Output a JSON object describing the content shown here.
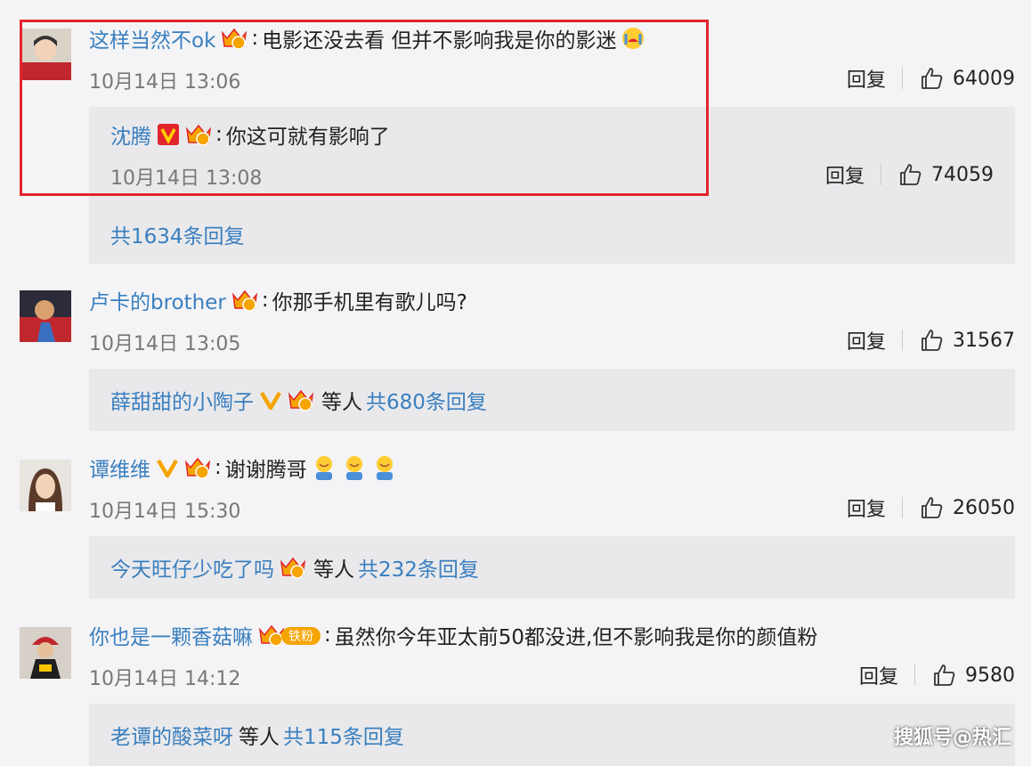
{
  "reply_label": "回复",
  "c1": {
    "user": "这样当然不ok",
    "text": "电影还没去看  但并不影响我是你的影迷",
    "time": "10月14日 13:06",
    "likes": "64009",
    "reply": {
      "user": "沈腾",
      "text": "你这可就有影响了",
      "time": "10月14日 13:08",
      "likes": "74059"
    },
    "more": "共1634条回复"
  },
  "c2": {
    "user": "卢卡的brother",
    "text": "你那手机里有歌儿吗?",
    "time": "10月14日 13:05",
    "likes": "31567",
    "sub_user": "薛甜甜的小陶子",
    "sub_etc": "等人",
    "more": "共680条回复"
  },
  "c3": {
    "user": "谭维维",
    "text": "谢谢腾哥",
    "time": "10月14日 15:30",
    "likes": "26050",
    "sub_user": "今天旺仔少吃了吗",
    "sub_etc": "等人",
    "more": "共232条回复"
  },
  "c4": {
    "user": "你也是一颗香菇嘛",
    "fan_badge": "铁粉",
    "text": "虽然你今年亚太前50都没进,但不影响我是你的颜值粉",
    "time": "10月14日 14:12",
    "likes": "9580",
    "sub_user": "老谭的酸菜呀",
    "sub_etc": "等人",
    "more": "共115条回复"
  },
  "watermark": "搜狐号@热汇",
  "colors": {
    "username": "#3a7fbf",
    "highlight": "#e2242c",
    "vip": "#f5a400"
  }
}
